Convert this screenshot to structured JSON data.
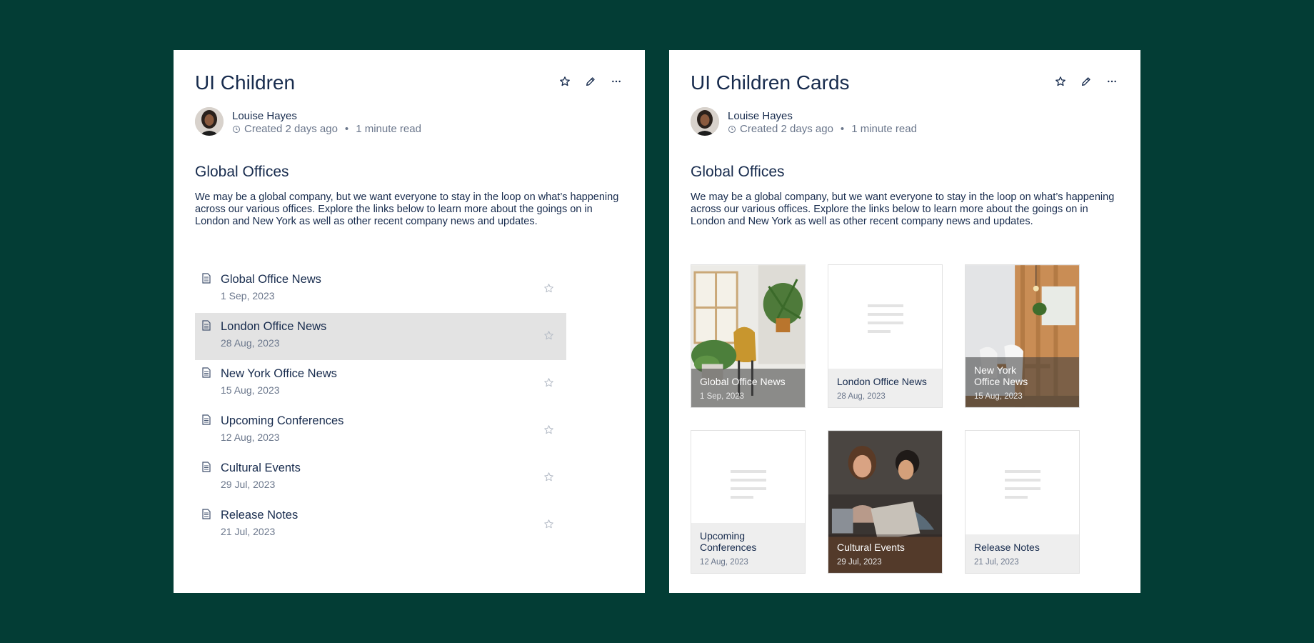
{
  "colors": {
    "background": "#033d35",
    "panel": "#ffffff",
    "text": "#172b4d",
    "muted": "#6b778c",
    "highlight": "#e3e3e3"
  },
  "left": {
    "title": "UI Children",
    "author": "Louise Hayes",
    "meta_created": "Created 2 days ago",
    "meta_separator": "•",
    "meta_read": "1 minute read",
    "heading": "Global Offices",
    "paragraph": "We may be a global company, but we want everyone to stay in the loop on what’s happening across our various offices. Explore the links below to learn more about the goings on in London and New York as well as other recent company news and updates.",
    "items": [
      {
        "title": "Global Office News",
        "date": "1 Sep, 2023"
      },
      {
        "title": "London Office News",
        "date": "28 Aug, 2023"
      },
      {
        "title": "New York Office News",
        "date": "15 Aug, 2023"
      },
      {
        "title": "Upcoming Conferences",
        "date": "12 Aug, 2023"
      },
      {
        "title": "Cultural Events",
        "date": "29 Jul, 2023"
      },
      {
        "title": "Release Notes",
        "date": "21 Jul, 2023"
      }
    ]
  },
  "right": {
    "title": "UI Children Cards",
    "author": "Louise Hayes",
    "meta_created": "Created 2 days ago",
    "meta_separator": "•",
    "meta_read": "1 minute read",
    "heading": "Global Offices",
    "paragraph": "We may be a global company, but we want everyone to stay in the loop on what’s happening across our various offices. Explore the links below to learn more about the goings on in London and New York as well as other recent company news and updates.",
    "cards": [
      {
        "title": "Global Office News",
        "date": "1 Sep, 2023",
        "image": "office-plants-photo"
      },
      {
        "title": "London Office News",
        "date": "28 Aug, 2023",
        "image": "placeholder"
      },
      {
        "title": "New York Office News",
        "date": "15 Aug, 2023",
        "image": "office-interior-photo"
      },
      {
        "title": "Upcoming Conferences",
        "date": "12 Aug, 2023",
        "image": "placeholder"
      },
      {
        "title": "Cultural Events",
        "date": "29 Jul, 2023",
        "image": "people-laptop-photo"
      },
      {
        "title": "Release Notes",
        "date": "21 Jul, 2023",
        "image": "placeholder"
      }
    ]
  },
  "icons": {
    "actions": [
      "star-icon",
      "pencil-icon",
      "more-icon"
    ],
    "item": "document-icon",
    "clock": "clock-icon"
  }
}
